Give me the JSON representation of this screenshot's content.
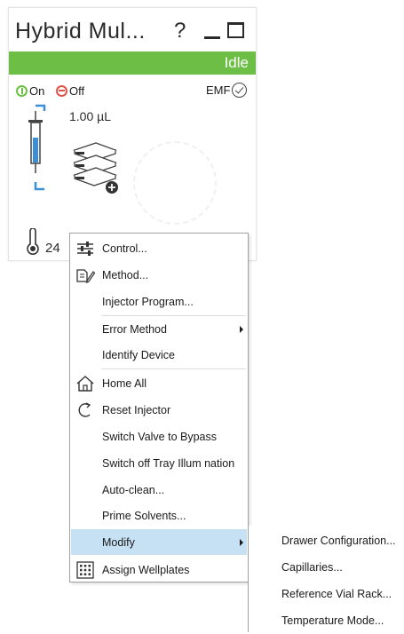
{
  "card": {
    "title": "Hybrid Mul...",
    "help_label": "?",
    "status": "Idle",
    "on_label": "On",
    "off_label": "Off",
    "emf_label": "EMF",
    "volume": "1.00 µL",
    "temperature": "24",
    "colors": {
      "status": "#6cbe45",
      "on": "#6cbe45",
      "off": "#e0524a"
    }
  },
  "menu": {
    "items": [
      {
        "label": "Control...",
        "icon": "sliders-icon"
      },
      {
        "label": "Method...",
        "icon": "method-edit-icon"
      },
      {
        "label": "Injector Program..."
      },
      {
        "label": "Error Method",
        "submenu": true
      },
      {
        "label": "Identify Device"
      },
      {
        "label": "Home All",
        "icon": "home-icon"
      },
      {
        "label": "Reset Injector",
        "icon": "reset-icon"
      },
      {
        "label": "Switch Valve to Bypass"
      },
      {
        "label": "Switch off Tray Illum nation"
      },
      {
        "label": "Auto-clean..."
      },
      {
        "label": "Prime Solvents..."
      },
      {
        "label": "Modify",
        "submenu": true,
        "highlighted": true
      },
      {
        "label": "Assign Wellplates",
        "icon": "wellplate-grid-icon"
      }
    ],
    "highlight_color": "#c6e1f4"
  },
  "submenu": {
    "items": [
      {
        "label": "Drawer Configuration..."
      },
      {
        "label": "Capillaries..."
      },
      {
        "label": "Reference Vial Rack..."
      },
      {
        "label": "Temperature Mode..."
      }
    ]
  }
}
